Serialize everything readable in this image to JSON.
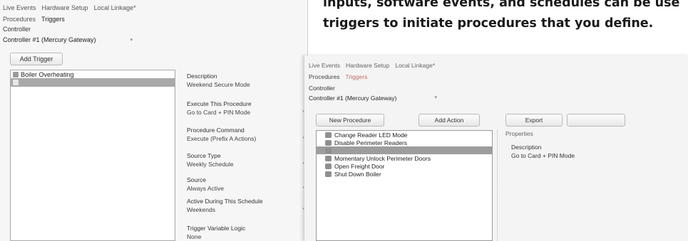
{
  "left_window": {
    "tabs": [
      "Live Events",
      "Hardware Setup",
      "Local Linkage*"
    ],
    "subtabs": [
      "Procedures",
      "Triggers"
    ],
    "controller_label": "Controller",
    "controller_value": "Controller #1 (Mercury Gateway)",
    "add_trigger_label": "Add Trigger",
    "trigger_items": [
      {
        "label": "Boiler Overheating",
        "selected": false
      },
      {
        "label": "",
        "selected": true
      }
    ],
    "properties": [
      {
        "name": "Description",
        "value": "Weekend Secure Mode"
      },
      {
        "name": "Execute This Procedure",
        "value": "Go to Card + PIN Mode"
      },
      {
        "name": "Procedure Command",
        "value": "Execute (Prefix A Actions)"
      },
      {
        "name": "Source Type",
        "value": "Weekly Schedule"
      },
      {
        "name": "Source",
        "value": "Always Active"
      },
      {
        "name": "Active During This Schedule",
        "value": "Weekends"
      },
      {
        "name": "Trigger Variable Logic",
        "value": "None"
      }
    ]
  },
  "caption": {
    "line1": "inputs, software events, and schedules can be use",
    "line2": "triggers to initiate procedures that you define."
  },
  "right_window": {
    "tabs": [
      "Live Events",
      "Hardware Setup",
      "Local Linkage*"
    ],
    "subtabs": [
      "Procedures",
      "Triggers"
    ],
    "controller_label": "Controller",
    "controller_value": "Controller #1 (Mercury Gateway)",
    "new_procedure_label": "New Procedure",
    "add_action_label": "Add Action",
    "export_label": "Export",
    "import_label": "",
    "properties_label": "Properties",
    "description_label": "Description",
    "description_value": "Go to Card + PIN Mode",
    "procedures": [
      {
        "label": "Change Reader LED Mode",
        "selected": false
      },
      {
        "label": "Disable Perimeter Readers",
        "selected": false
      },
      {
        "label": "",
        "selected": true
      },
      {
        "label": "Momentary Unlock Perimeter Doors",
        "selected": false
      },
      {
        "label": "Open Freight Door",
        "selected": false
      },
      {
        "label": "Shut Down Boiler",
        "selected": false
      }
    ]
  }
}
